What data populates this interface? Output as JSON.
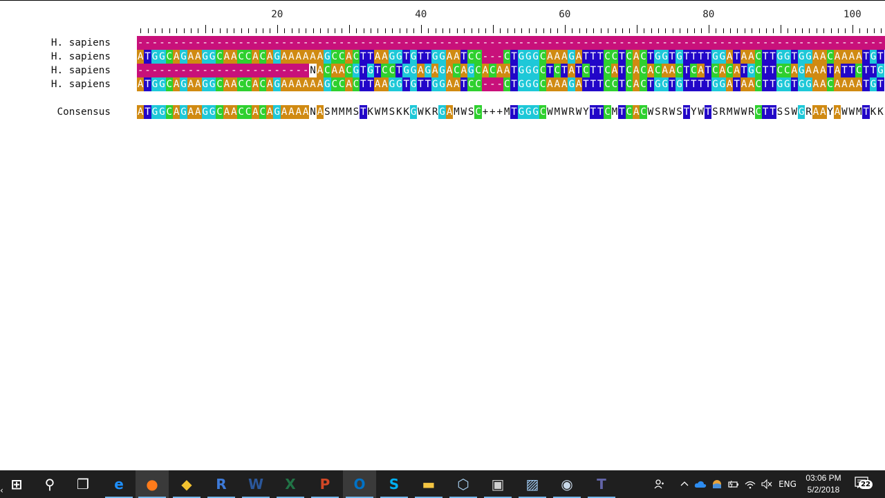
{
  "ruler": {
    "labels": [
      {
        "text": "20",
        "col": 20
      },
      {
        "text": "40",
        "col": 40
      },
      {
        "text": "60",
        "col": 60
      },
      {
        "text": "80",
        "col": 80
      },
      {
        "text": "100",
        "col": 100
      }
    ]
  },
  "alignment": {
    "rows": [
      {
        "label": "H. sapiens",
        "seq": "---------------------------------------------------------------------------------------------------------"
      },
      {
        "label": "H. sapiens",
        "seq": "ATGGCAGAAGGCAACCACAGAAAAAAGCCACTTAAGGTGTTGGAATCC---CTGGGCAAAGATTTCCTCACTGGTGTTTTGGATAACTTGGTGGAACAAAATGT"
      },
      {
        "label": "H. sapiens",
        "seq": "------------------------NACAACGTGTCCTGGAGAGACAGCACAATGGGCTCTATCTTCATCACACAACTCATCACATGCTTCCAGAAATATTCTTG"
      },
      {
        "label": "H. sapiens",
        "seq": "ATGGCAGAAGGCAACCACAGAAAAAAGCCACTTAAGGTGTTGGAATCC---CTGGGCAAAGATTTCCTCACTGGTGTTTTGGATAACTTGGTGGAACAAAATGT"
      }
    ],
    "consensus": {
      "label": "Consensus",
      "seq": "ATGGCAGAAGGCAACCACAGAAAANASMMMSTKWMSKKGWKRGAMWSC+++MTGGGCWMWRWYTTCMTCACWSRWSTYWTSRMWWRCTTSSWGRAAYAWWMTKK"
    }
  },
  "taskbar": {
    "apps": [
      {
        "name": "start-button",
        "icon": "windows-logo-icon",
        "glyph": "⊞",
        "color": "#ffffff"
      },
      {
        "name": "search-button",
        "icon": "search-icon",
        "glyph": "⚲",
        "color": "#ffffff"
      },
      {
        "name": "task-view-button",
        "icon": "task-view-icon",
        "glyph": "❐",
        "color": "#ffffff"
      },
      {
        "name": "edge-app",
        "icon": "edge-icon",
        "glyph": "e",
        "color": "#1e90ff"
      },
      {
        "name": "firefox-app",
        "icon": "firefox-icon",
        "glyph": "●",
        "color": "#ff7b1a"
      },
      {
        "name": "tool-app",
        "icon": "diamond-tool-icon",
        "glyph": "◆",
        "color": "#f2c230"
      },
      {
        "name": "r-app",
        "icon": "r-logo-icon",
        "glyph": "R",
        "color": "#3d7ad8"
      },
      {
        "name": "word-app",
        "icon": "word-icon",
        "glyph": "W",
        "color": "#2b579a"
      },
      {
        "name": "excel-app",
        "icon": "excel-icon",
        "glyph": "X",
        "color": "#217346"
      },
      {
        "name": "powerpoint-app",
        "icon": "powerpoint-icon",
        "glyph": "P",
        "color": "#d24726"
      },
      {
        "name": "outlook-app",
        "icon": "outlook-icon",
        "glyph": "O",
        "color": "#0072c6"
      },
      {
        "name": "skype-app",
        "icon": "skype-icon",
        "glyph": "S",
        "color": "#00aff0"
      },
      {
        "name": "file-explorer-app",
        "icon": "folder-icon",
        "glyph": "▬",
        "color": "#f4c542"
      },
      {
        "name": "virtualbox-app",
        "icon": "cube-icon",
        "glyph": "⬡",
        "color": "#a8d0f0"
      },
      {
        "name": "toggle-app",
        "icon": "toggle-settings-icon",
        "glyph": "▣",
        "color": "#cfcfcf"
      },
      {
        "name": "image-viewer-app",
        "icon": "image-icon",
        "glyph": "▨",
        "color": "#9ec8f0"
      },
      {
        "name": "steam-app",
        "icon": "steam-icon",
        "glyph": "◉",
        "color": "#c8d8e8"
      },
      {
        "name": "teams-app",
        "icon": "teams-icon",
        "glyph": "T",
        "color": "#6264a7"
      }
    ],
    "tray": {
      "people_icon": "people-icon",
      "chevron_icon": "chevron-up-icon",
      "onedrive_icon": "cloud-icon",
      "weather_icon": "weather-icon",
      "battery_icon": "battery-icon",
      "wifi_icon": "wifi-icon",
      "volume_icon": "volume-muted-icon",
      "language": "ENG",
      "time": "03:06 PM",
      "date": "5/2/2018",
      "notifications_count": "22",
      "notifications_icon": "notification-icon"
    }
  }
}
